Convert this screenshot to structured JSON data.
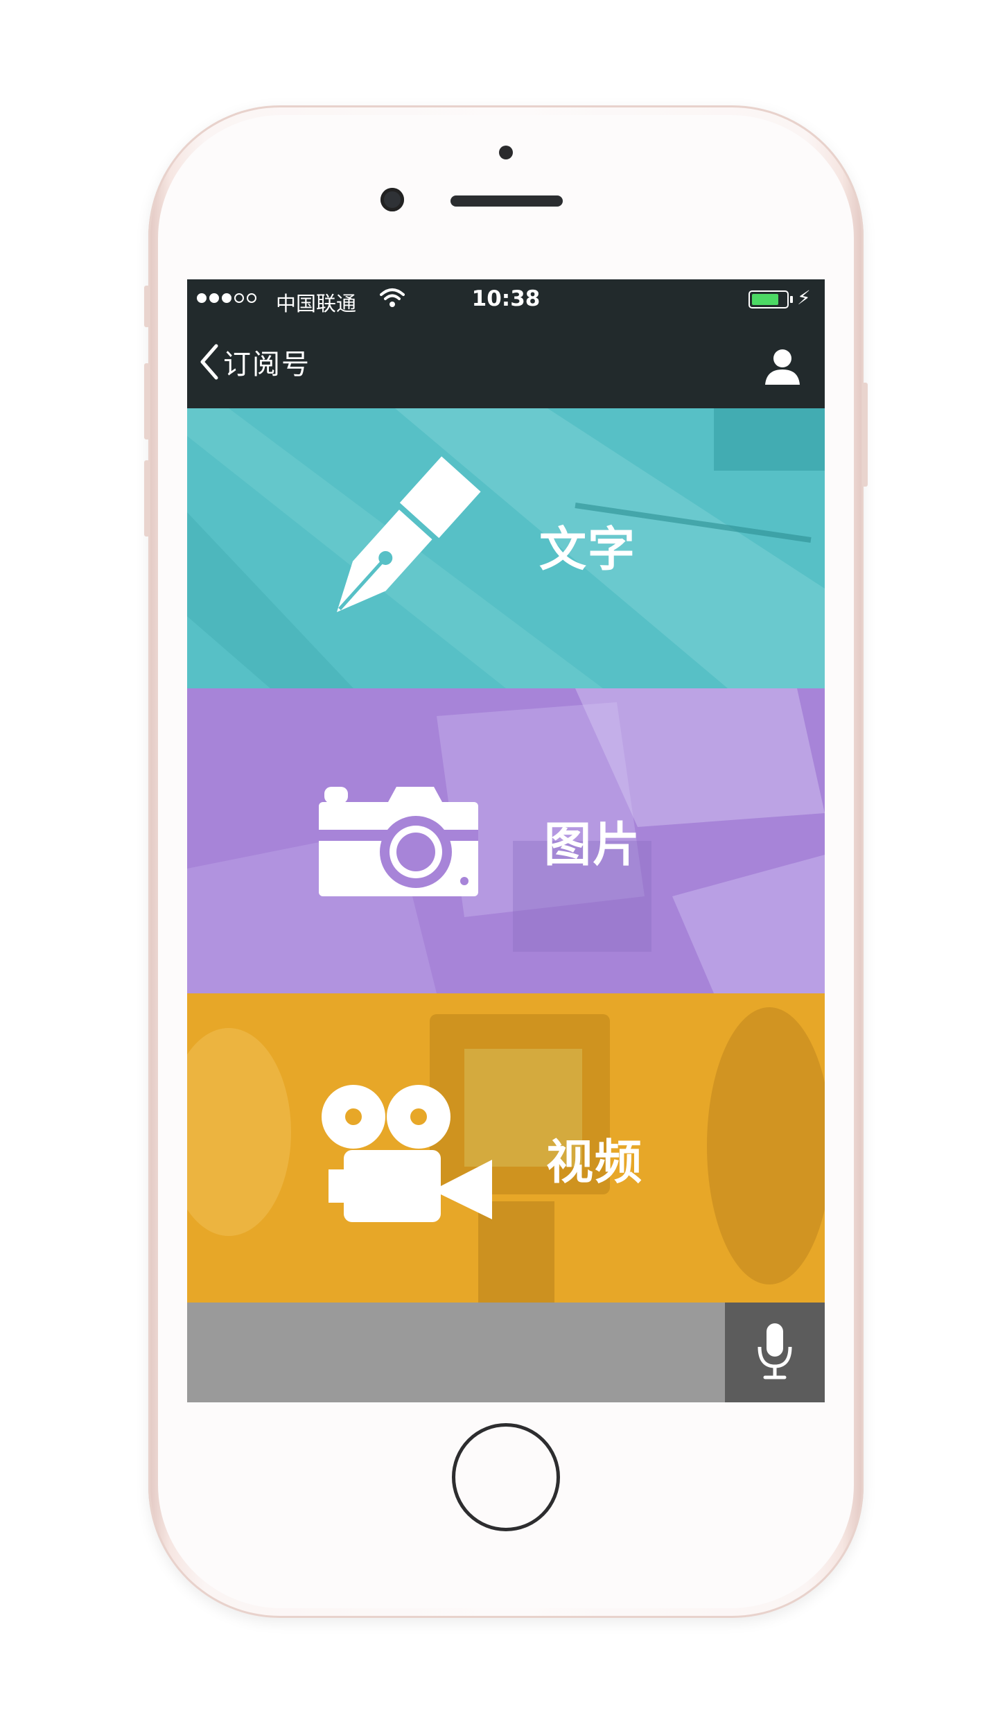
{
  "statusbar": {
    "carrier": "中国联通",
    "time": "10:38",
    "battery_level": 0.8,
    "battery_color": "#4cd964"
  },
  "navbar": {
    "back_label": "订阅号",
    "back_icon": "chevron-left-icon",
    "profile_icon": "user-icon"
  },
  "panels": [
    {
      "label": "文字",
      "icon": "fountain-pen-icon",
      "color": "#57c0c6"
    },
    {
      "label": "图片",
      "icon": "camera-icon",
      "color": "#a784d8"
    },
    {
      "label": "视频",
      "icon": "movie-camera-icon",
      "color": "#e7a728"
    }
  ],
  "inputbar": {
    "mic_icon": "microphone-icon",
    "background": "#9a9a9a",
    "mic_background": "#5c5c5c"
  }
}
